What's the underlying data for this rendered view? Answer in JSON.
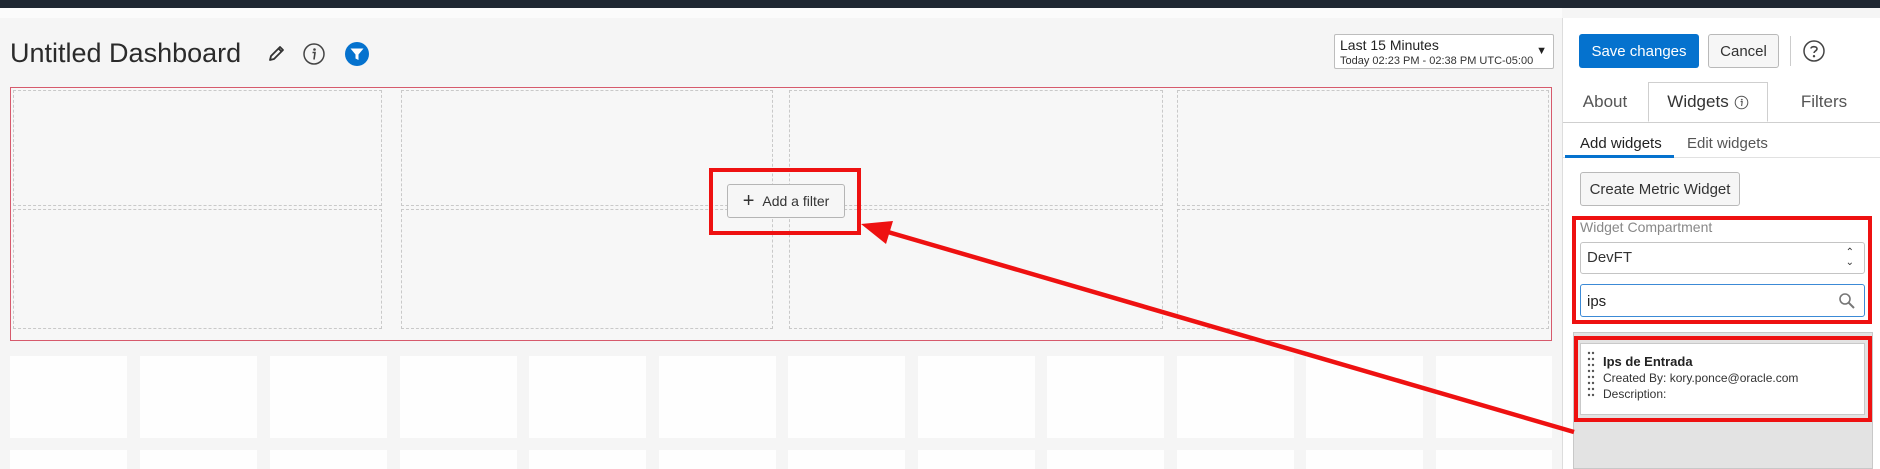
{
  "header": {
    "title": "Untitled Dashboard"
  },
  "time_picker": {
    "range_label": "Last 15 Minutes",
    "range_detail": "Today 02:23 PM - 02:38 PM UTC-05:00"
  },
  "canvas": {
    "add_filter_label": "Add a filter"
  },
  "toolbar": {
    "save_label": "Save changes",
    "cancel_label": "Cancel"
  },
  "panel_tabs": {
    "about": "About",
    "widgets": "Widgets",
    "filters": "Filters",
    "active": "Widgets"
  },
  "widgets_subtabs": {
    "add": "Add widgets",
    "edit": "Edit widgets",
    "active": "Add widgets"
  },
  "create_metric_label": "Create Metric Widget",
  "compartment": {
    "label": "Widget Compartment",
    "value": "DevFT"
  },
  "search": {
    "value": "ips"
  },
  "results": [
    {
      "name": "Ips de Entrada",
      "created_by": "Created By: kory.ponce@oracle.com",
      "description": "Description:"
    }
  ],
  "icons": {
    "edit": "pencil-icon",
    "info": "info-icon",
    "filter": "funnel-icon",
    "help": "help-icon",
    "search": "search-icon",
    "drag": "drag-handle-icon"
  },
  "colors": {
    "primary": "#0572ce",
    "annotation": "#ee1111",
    "filter_zone_border": "#d65a6c",
    "topbar": "#1f2732"
  }
}
